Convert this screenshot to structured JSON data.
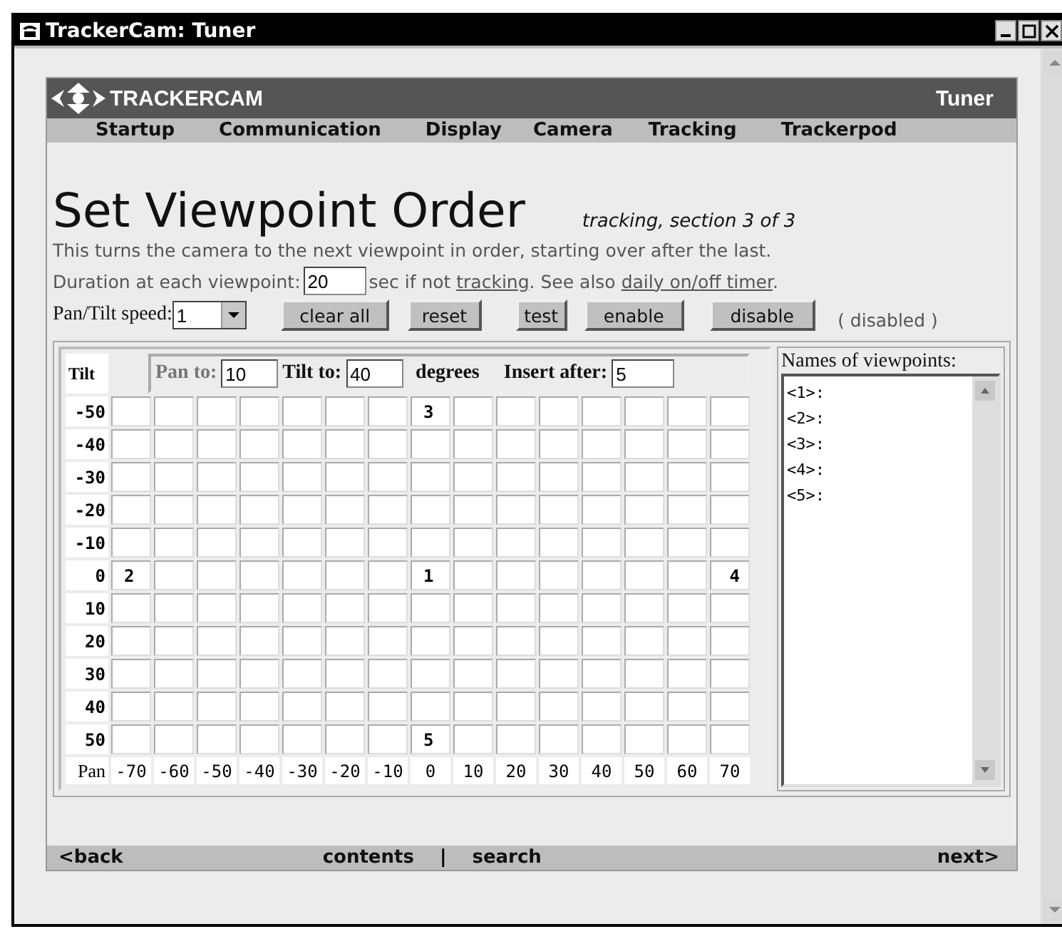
{
  "window": {
    "title": "TrackerCam: Tuner"
  },
  "header": {
    "brand": "TRACKERCAM",
    "page": "Tuner"
  },
  "nav": [
    "Startup",
    "Communication",
    "Display",
    "Camera",
    "Tracking",
    "Trackerpod"
  ],
  "heading": "Set Viewpoint Order",
  "section": "tracking, section 3 of 3",
  "description": "This turns the camera to the next viewpoint in order, starting over after the last.",
  "duration": {
    "label": "Duration at each viewpoint:",
    "value": "20",
    "after": "sec if not",
    "link": "tracking",
    "see_also": ". See also",
    "timer_link": "daily on/off timer",
    "end": "."
  },
  "speed": {
    "label": "Pan/Tilt speed:",
    "value": "1"
  },
  "buttons": [
    "clear all",
    "reset",
    "test",
    "enable",
    "disable"
  ],
  "status": "( disabled )",
  "grid": {
    "corner": "Tilt",
    "pan_label": "Pan to:",
    "pan_value": "10",
    "tilt_label": "Tilt to:",
    "tilt_value": "40",
    "degrees": "degrees",
    "insert_label": "Insert after:",
    "insert_value": "5",
    "rows": [
      {
        "tilt": "-50",
        "cells": [
          {},
          {},
          {},
          {},
          {},
          {},
          {},
          {
            "label": "3"
          },
          {},
          {},
          {},
          {},
          {},
          {},
          {}
        ]
      },
      {
        "tilt": "-40",
        "cells": [
          {},
          {},
          {},
          {},
          {},
          {},
          {},
          {},
          {},
          {},
          {},
          {},
          {},
          {},
          {}
        ]
      },
      {
        "tilt": "-30",
        "cells": [
          {},
          {},
          {},
          {},
          {},
          {},
          {},
          {},
          {},
          {},
          {},
          {},
          {},
          {},
          {}
        ]
      },
      {
        "tilt": "-20",
        "cells": [
          {},
          {},
          {},
          {},
          {},
          {},
          {},
          {},
          {},
          {},
          {},
          {},
          {},
          {},
          {}
        ]
      },
      {
        "tilt": "-10",
        "cells": [
          {},
          {},
          {},
          {},
          {},
          {},
          {},
          {},
          {},
          {},
          {},
          {},
          {},
          {},
          {}
        ]
      },
      {
        "tilt": "0",
        "cells": [
          {
            "label": "2"
          },
          {},
          {},
          {},
          {},
          {},
          {},
          {
            "label": "1"
          },
          {},
          {},
          {},
          {},
          {},
          {},
          {
            "label": "4"
          }
        ]
      },
      {
        "tilt": "10",
        "cells": [
          {},
          {},
          {},
          {},
          {},
          {},
          {},
          {},
          {},
          {},
          {},
          {},
          {},
          {},
          {}
        ]
      },
      {
        "tilt": "20",
        "cells": [
          {},
          {},
          {},
          {},
          {},
          {},
          {},
          {},
          {},
          {},
          {},
          {},
          {},
          {},
          {}
        ]
      },
      {
        "tilt": "30",
        "cells": [
          {},
          {},
          {},
          {},
          {},
          {},
          {},
          {},
          {},
          {},
          {},
          {},
          {},
          {},
          {}
        ]
      },
      {
        "tilt": "40",
        "cells": [
          {},
          {},
          {},
          {},
          {},
          {},
          {},
          {},
          {},
          {},
          {},
          {},
          {},
          {},
          {}
        ]
      },
      {
        "tilt": "50",
        "cells": [
          {},
          {},
          {},
          {},
          {},
          {},
          {},
          {
            "label": "5"
          },
          {},
          {},
          {},
          {},
          {},
          {},
          {}
        ]
      }
    ],
    "pan_axis": "Pan",
    "pans": [
      "-70",
      "-60",
      "-50",
      "-40",
      "-30",
      "-20",
      "-10",
      "0",
      "10",
      "20",
      "30",
      "40",
      "50",
      "60",
      "70"
    ]
  },
  "names": {
    "title": "Names of viewpoints:",
    "lines": [
      "<1>:",
      "<2>:",
      "<3>:",
      "<4>:",
      "<5>:"
    ]
  },
  "footer": {
    "back": "<back",
    "contents": "contents",
    "separator": "|",
    "search": "search",
    "next": "next>"
  }
}
